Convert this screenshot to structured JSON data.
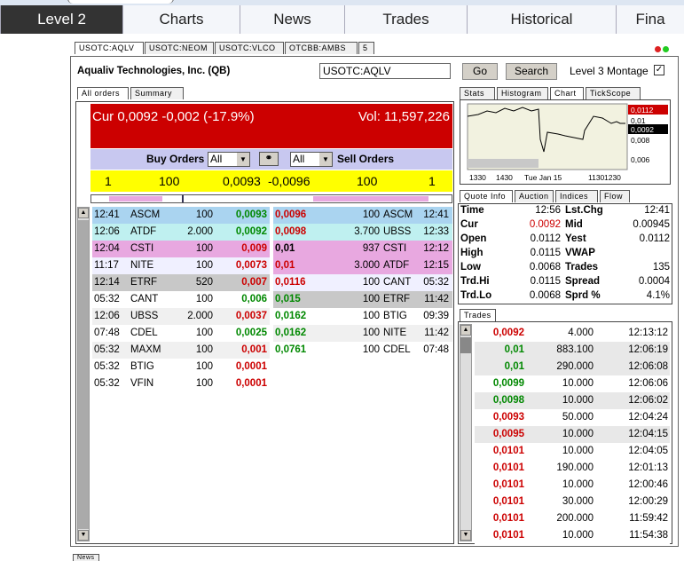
{
  "nav": [
    "Level 2",
    "Charts",
    "News",
    "Trades",
    "Historical",
    "Fina"
  ],
  "symtabs": [
    "USOTC:AQLV",
    "USOTC:NEOM",
    "USOTC:VLCO",
    "OTCBB:AMBS",
    "5"
  ],
  "company": "Aqualiv Technologies, Inc. (QB)",
  "symbol_input": "USOTC:AQLV",
  "go": "Go",
  "search": "Search",
  "level3": "Level 3 Montage",
  "ordertabs": [
    "All orders",
    "Summary"
  ],
  "cur": "Cur 0,0092 -0,002 (-17.9%)",
  "vol": "Vol: 11,597,226",
  "buy_orders": "Buy Orders",
  "sell_orders": "Sell Orders",
  "buy_filter": "All",
  "sell_filter": "All",
  "summary": {
    "bcnt": "1",
    "bsize": "100",
    "bid": "0,0093",
    "ask": "-0,0096",
    "asize": "100",
    "acnt": "1"
  },
  "bids": [
    [
      "12:41",
      "ASCM",
      "100",
      "0,0093"
    ],
    [
      "12:06",
      "ATDF",
      "2.000",
      "0,0092"
    ],
    [
      "12:04",
      "CSTI",
      "100",
      "0,009"
    ],
    [
      "11:17",
      "NITE",
      "100",
      "0,0073"
    ],
    [
      "12:14",
      "ETRF",
      "520",
      "0,007"
    ],
    [
      "05:32",
      "CANT",
      "100",
      "0,006"
    ],
    [
      "12:06",
      "UBSS",
      "2.000",
      "0,0037"
    ],
    [
      "07:48",
      "CDEL",
      "100",
      "0,0025"
    ],
    [
      "05:32",
      "MAXM",
      "100",
      "0,001"
    ],
    [
      "05:32",
      "BTIG",
      "100",
      "0,0001"
    ],
    [
      "05:32",
      "VFIN",
      "100",
      "0,0001"
    ]
  ],
  "asks": [
    [
      "0,0096",
      "100",
      "ASCM",
      "12:41"
    ],
    [
      "0,0098",
      "3.700",
      "UBSS",
      "12:33"
    ],
    [
      "0,01",
      "937",
      "CSTI",
      "12:12"
    ],
    [
      "0,01",
      "3.000",
      "ATDF",
      "12:15"
    ],
    [
      "0,0116",
      "100",
      "CANT",
      "05:32"
    ],
    [
      "0,015",
      "100",
      "ETRF",
      "11:42"
    ],
    [
      "0,0162",
      "100",
      "BTIG",
      "09:39"
    ],
    [
      "0,0162",
      "100",
      "NITE",
      "11:42"
    ],
    [
      "0,0761",
      "100",
      "CDEL",
      "07:48"
    ]
  ],
  "charttabs": [
    "Stats",
    "Histogram",
    "Chart",
    "TickScope"
  ],
  "chart": {
    "prices": [
      "0,0112",
      "0,01",
      "0,0092",
      "0,008",
      "0,006"
    ],
    "times": [
      "1330",
      "1430",
      "Tue Jan 15",
      "1130",
      "1230"
    ]
  },
  "qtabs": [
    "Quote Info",
    "Auction",
    "Indices",
    "Flow"
  ],
  "quote": [
    [
      "Time",
      "12:56",
      "Lst.Chg",
      "12:41"
    ],
    [
      "Cur",
      "0.0092",
      "Mid",
      "0.00945"
    ],
    [
      "Open",
      "0.0112",
      "Yest",
      "0.0112"
    ],
    [
      "High",
      "0.0115",
      "VWAP",
      ""
    ],
    [
      "Low",
      "0.0068",
      "Trades",
      "135"
    ],
    [
      "Trd.Hi",
      "0.0115",
      "Spread",
      "0.0004"
    ],
    [
      "Trd.Lo",
      "0.0068",
      "Sprd %",
      "4.1%"
    ]
  ],
  "tradestab": "Trades",
  "trades": [
    [
      "0,0092",
      "4.000",
      "12:13:12"
    ],
    [
      "0,01",
      "883.100",
      "12:06:19"
    ],
    [
      "0,01",
      "290.000",
      "12:06:08"
    ],
    [
      "0,0099",
      "10.000",
      "12:06:06"
    ],
    [
      "0,0098",
      "10.000",
      "12:06:02"
    ],
    [
      "0,0093",
      "50.000",
      "12:04:24"
    ],
    [
      "0,0095",
      "10.000",
      "12:04:15"
    ],
    [
      "0,0101",
      "10.000",
      "12:04:05"
    ],
    [
      "0,0101",
      "190.000",
      "12:01:13"
    ],
    [
      "0,0101",
      "10.000",
      "12:00:46"
    ],
    [
      "0,0101",
      "30.000",
      "12:00:29"
    ],
    [
      "0,0101",
      "200.000",
      "11:59:42"
    ],
    [
      "0,0101",
      "10.000",
      "11:54:38"
    ]
  ],
  "bottomtab": "News",
  "colors": {
    "curbar": "#cc0000",
    "buyhdr": "#c8c8f0",
    "yellow": "#ffff00",
    "red": "#cc0000",
    "green": "#008800"
  }
}
